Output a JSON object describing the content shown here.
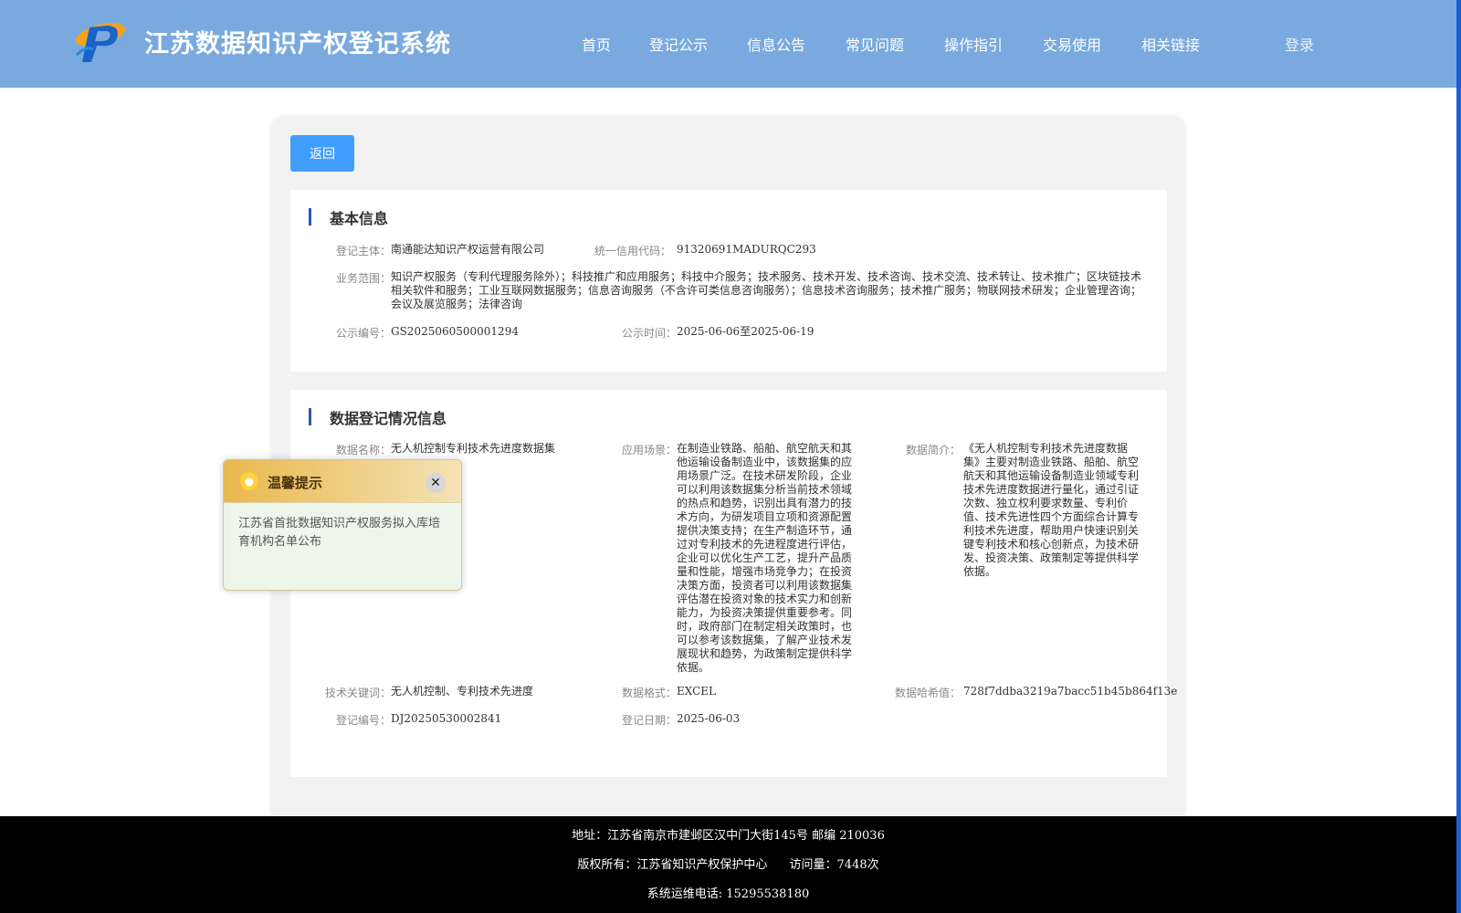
{
  "header": {
    "site_title": "江苏数据知识产权登记系统",
    "nav": [
      "首页",
      "登记公示",
      "信息公告",
      "常见问题",
      "操作指引",
      "交易使用",
      "相关链接"
    ],
    "login": "登录"
  },
  "back_label": "返回",
  "basic_info": {
    "title": "基本信息",
    "subject_label": "登记主体：",
    "subject": "南通能达知识产权运营有限公司",
    "credit_code_label": "统一信用代码：",
    "credit_code": "91320691MADURQC293",
    "scope_label": "业务范围：",
    "scope": "知识产权服务（专利代理服务除外）；科技推广和应用服务；科技中介服务；技术服务、技术开发、技术咨询、技术交流、技术转让、技术推广；区块链技术相关软件和服务；工业互联网数据服务；信息咨询服务（不含许可类信息咨询服务）；信息技术咨询服务；技术推广服务；物联网技术研发；企业管理咨询；会议及展览服务；法律咨询",
    "notice_no_label": "公示编号：",
    "notice_no": "GS2025060500001294",
    "notice_time_label": "公示时间：",
    "notice_time": "2025-06-06至2025-06-19"
  },
  "data_info": {
    "title": "数据登记情况信息",
    "name_label": "数据名称：",
    "name": "无人机控制专利技术先进度数据集",
    "scene_label": "应用场景：",
    "scene": "在制造业铁路、船舶、航空航天和其他运输设备制造业中，该数据集的应用场景广泛。在技术研发阶段，企业可以利用该数据集分析当前技术领域的热点和趋势，识别出具有潜力的技术方向，为研发项目立项和资源配置提供决策支持；在生产制造环节，通过对专利技术的先进程度进行评估，企业可以优化生产工艺，提升产品质量和性能，增强市场竞争力；在投资决策方面，投资者可以利用该数据集评估潜在投资对象的技术实力和创新能力，为投资决策提供重要参考。同时，政府部门在制定相关政策时，也可以参考该数据集，了解产业技术发展现状和趋势，为政策制定提供科学依据。",
    "intro_label": "数据简介：",
    "intro": "《无人机控制专利技术先进度数据集》主要对制造业铁路、船舶、航空航天和其他运输设备制造业领域专利技术先进度数据进行量化，通过引证次数、独立权利要求数量、专利价值、技术先进性四个方面综合计算专利技术先进度，帮助用户快速识别关键专利技术和核心创新点，为技术研发、投资决策、政策制定等提供科学依据。",
    "keywords_label": "技术关键词：",
    "keywords": "无人机控制、专利技术先进度",
    "format_label": "数据格式：",
    "format": "EXCEL",
    "hash_label": "数据哈希值：",
    "hash": "728f7ddba3219a7bacc51b45b864f13e",
    "reg_no_label": "登记编号：",
    "reg_no": "DJ20250530002841",
    "reg_date_label": "登记日期：",
    "reg_date": "2025-06-03"
  },
  "popup": {
    "title": "温馨提示",
    "message": "江苏省首批数据知识产权服务拟入库培育机构名单公布",
    "icon": "lightbulb-icon"
  },
  "footer": {
    "address": "地址：江苏省南京市建邺区汉中门大街145号 邮编 210036",
    "copyright": "版权所有：江苏省知识产权保护中心",
    "visits": "访问量：7448次",
    "hotline": "系统运维电话: 15295538180"
  },
  "colors": {
    "header_bg": "#79a9df",
    "primary_button": "#409eff",
    "footer_bg": "#000000",
    "section_marker": "#2a5aa8"
  }
}
